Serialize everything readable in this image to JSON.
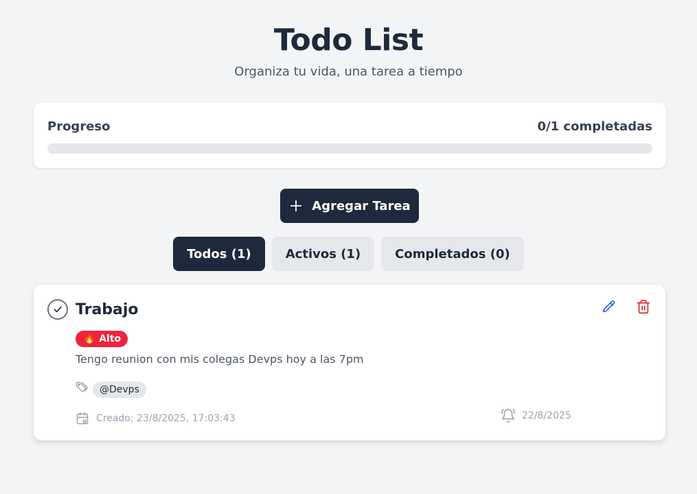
{
  "header": {
    "title": "Todo List",
    "subtitle": "Organiza tu vida, una tarea a tiempo"
  },
  "progress": {
    "label": "Progreso",
    "count_text": "0/1 completadas",
    "completed": 0,
    "total": 1
  },
  "add_button": {
    "label": "Agregar Tarea",
    "icon": "plus-icon"
  },
  "filters": [
    {
      "label": "Todos (1)",
      "active": true
    },
    {
      "label": "Activos (1)",
      "active": false
    },
    {
      "label": "Completados (0)",
      "active": false
    }
  ],
  "tasks": [
    {
      "title": "Trabajo",
      "priority": {
        "label": "Alto",
        "icon": "fire-icon",
        "color": "#ef233c"
      },
      "description": "Tengo reunion con mis colegas Devps hoy a las 7pm",
      "tags": [
        "@Devps"
      ],
      "created": "Creado: 23/8/2025, 17:03:43",
      "due": "22/8/2025",
      "completed": false
    }
  ],
  "colors": {
    "primary": "#1e293b",
    "background": "#f3f4f6",
    "edit": "#2563eb",
    "delete": "#dc2626",
    "priority_high": "#ef233c"
  }
}
